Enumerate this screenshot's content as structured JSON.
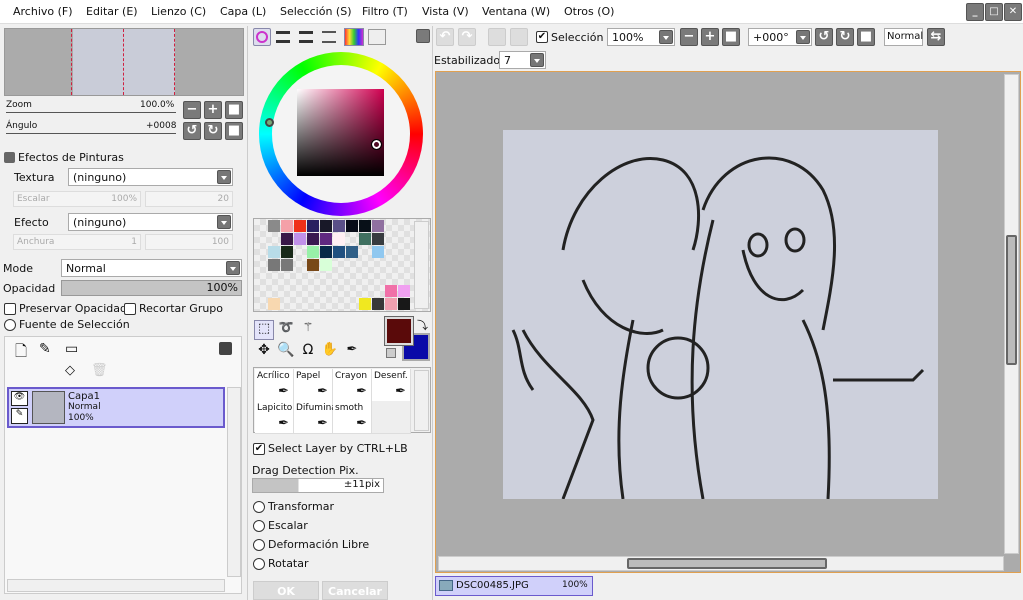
{
  "menu": [
    "Archivo (F)",
    "Editar (E)",
    "Lienzo (C)",
    "Capa (L)",
    "Selección (S)",
    "Filtro (T)",
    "Vista (V)",
    "Ventana (W)",
    "Otros (O)"
  ],
  "navigator": {
    "zoom_label": "Zoom",
    "zoom_value": "100.0%",
    "angle_label": "Ángulo",
    "angle_value": "+0008"
  },
  "effects": {
    "title": "Efectos de Pinturas",
    "texture_label": "Textura",
    "texture_value": "(ninguno)",
    "scale_label": "Escalar",
    "scale_value": "100%",
    "scale_strength": "20",
    "effect_label": "Efecto",
    "effect_value": "(ninguno)",
    "width_label": "Anchura",
    "width_value": "1",
    "width_strength": "100"
  },
  "layer_props": {
    "mode_label": "Mode",
    "mode_value": "Normal",
    "opacity_label": "Opacidad",
    "opacity_value": "100%",
    "opacity_percent": 100,
    "preserve_opacity": "Preservar Opacidad",
    "clip_group": "Recortar Grupo",
    "selection_source": "Fuente de Selección"
  },
  "layers": [
    {
      "name": "Capa1",
      "mode": "Normal",
      "opacity": "100%",
      "visible": true,
      "selected": true
    }
  ],
  "colors": {
    "primary": "#5a0a0a",
    "secondary": "#0a0aa8",
    "accent": "#6a5acd",
    "selected_layer_bg": "#d0d0fa"
  },
  "palette": [
    [
      "",
      "#8a8a8a",
      "#f4a0a8",
      "#f03018",
      "#282060",
      "#181828",
      "#5a5088",
      "#080c18",
      "#081018",
      "#9070a0",
      "",
      ""
    ],
    [
      "",
      "",
      "#3a1848",
      "#c090e8",
      "#381850",
      "#602880",
      "#fff0f4",
      "",
      "#407060",
      "#383c40",
      "",
      ""
    ],
    [
      "",
      "#b8dce8",
      "#182818",
      "",
      "#98f0a8",
      "#082848",
      "#205080",
      "#306088",
      "",
      "#90c8f0",
      "",
      ""
    ],
    [
      "",
      "#787878",
      "#787878",
      "",
      "#784818",
      "#d8ffd8",
      "",
      "",
      "",
      "",
      "",
      ""
    ],
    [
      "",
      "",
      "",
      "",
      "",
      "",
      "",
      "",
      "",
      "",
      "",
      ""
    ],
    [
      "",
      "",
      "",
      "",
      "",
      "",
      "",
      "",
      "",
      "",
      "#f070a8",
      "#f0a0f0"
    ],
    [
      "",
      "#f8d8b0",
      "",
      "",
      "",
      "",
      "",
      "",
      "#f0e820",
      "#383838",
      "#f0a0b0",
      "#181818"
    ]
  ],
  "brushes": [
    "Acrílico",
    "Papel",
    "Crayon",
    "Desenf.",
    "Lapicito",
    "Difumina",
    "smoth",
    ""
  ],
  "tool_options": {
    "select_layer": "Select Layer by CTRL+LB",
    "select_layer_checked": true,
    "drag_label": "Drag Detection Pix.",
    "drag_value": "±11pix",
    "transform": "Transformar",
    "scale": "Escalar",
    "free_deform": "Deformación Libre",
    "rotate": "Rotatar",
    "ok": "OK",
    "cancel": "Cancelar"
  },
  "toolbar": {
    "selection_label": "Selección",
    "selection_checked": true,
    "zoom": "100%",
    "angle": "+000°",
    "blend": "Normal",
    "stabilizer_label": "Estabilizador",
    "stabilizer_value": "7"
  },
  "document_tab": {
    "name": "DSC00485.JPG",
    "zoom": "100%"
  }
}
